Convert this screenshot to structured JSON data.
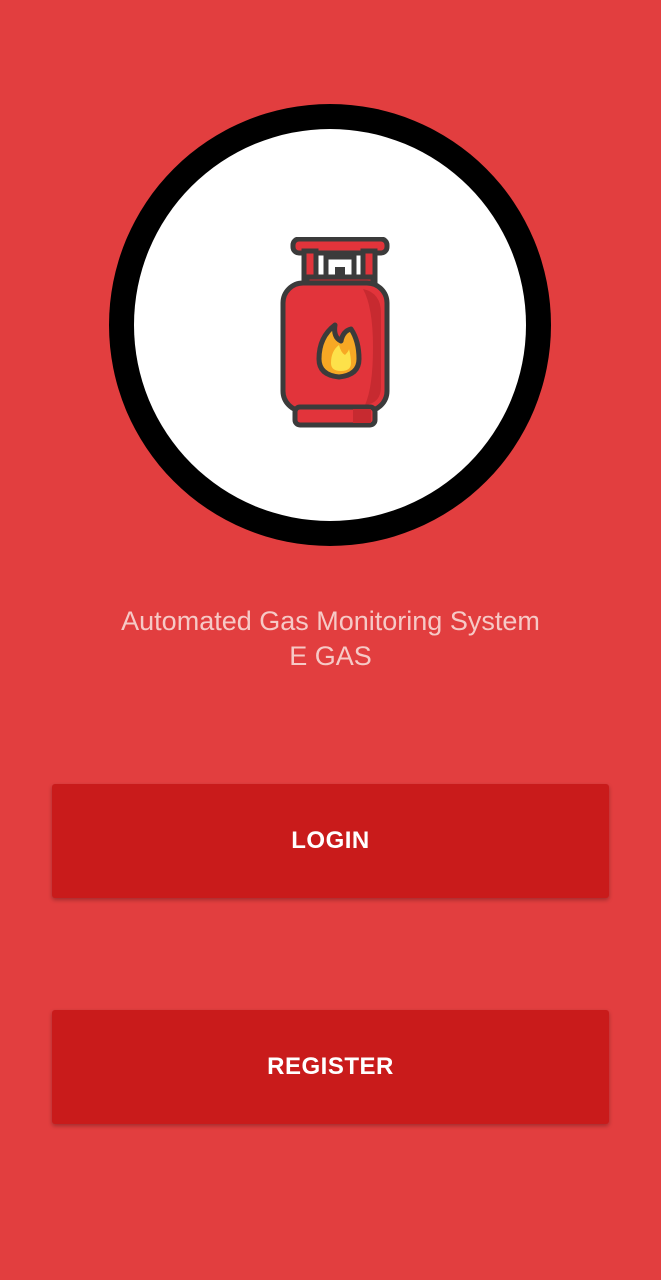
{
  "app": {
    "logo_icon": "gas-cylinder-icon",
    "tagline_line1": "Automated Gas Monitoring System",
    "tagline_line2": "E GAS"
  },
  "actions": {
    "login_label": "LOGIN",
    "register_label": "REGISTER"
  },
  "colors": {
    "background": "#e23e3f",
    "button": "#c91b1b",
    "button_text": "#ffffff",
    "tagline_text": "#f6c9c6",
    "logo_ring": "#000000",
    "logo_fill": "#ffffff",
    "cylinder_body": "#e2343b",
    "flame_outer": "#f7a824",
    "flame_inner": "#fde14a"
  }
}
